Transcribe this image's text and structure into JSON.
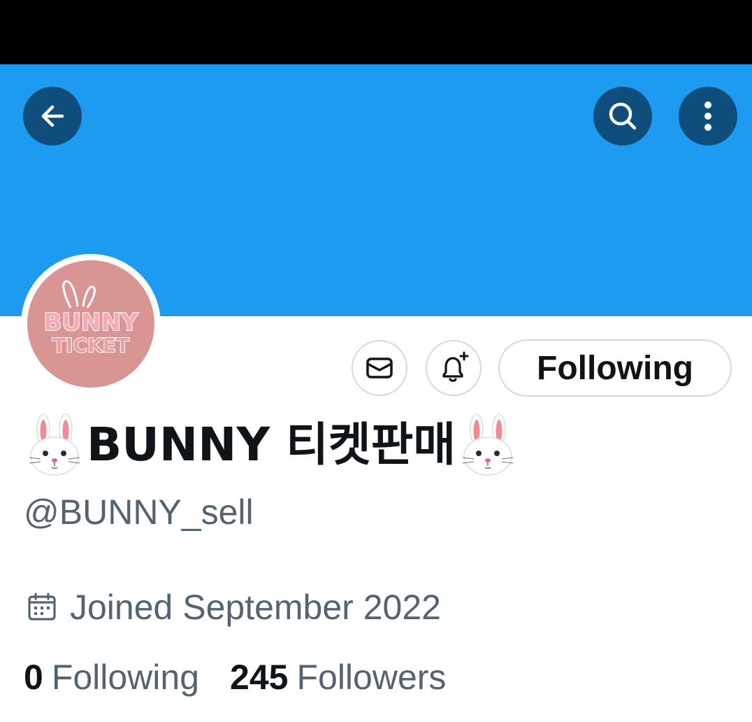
{
  "colors": {
    "banner": "#1d9bf0",
    "header_button_bg": "#0f4d7d",
    "avatar_bg": "#d99494",
    "primary_text": "#0f1419",
    "secondary_text": "#536471",
    "button_border": "#cfd9de"
  },
  "header": {
    "back_icon": "arrow-left-icon",
    "search_icon": "search-icon",
    "more_icon": "more-vertical-icon"
  },
  "avatar": {
    "logo_line1": "BUNNY",
    "logo_line2": "TICKET"
  },
  "actions": {
    "message_icon": "envelope-icon",
    "notify_icon": "bell-plus-icon",
    "following_label": "Following"
  },
  "profile": {
    "display_name": "BUNNY 티켓판매",
    "name_emoji": "rabbit-face-icon",
    "handle": "@BUNNY_sell",
    "joined": "Joined September 2022",
    "joined_icon": "calendar-icon"
  },
  "stats": {
    "following_count": "0",
    "following_label": "Following",
    "followers_count": "245",
    "followers_label": "Followers"
  }
}
